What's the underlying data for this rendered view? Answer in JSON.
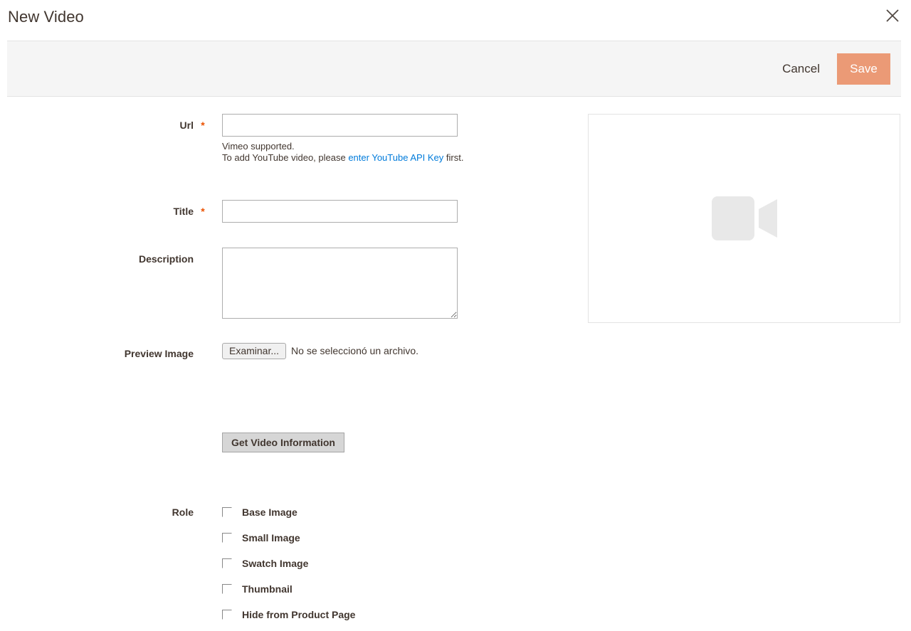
{
  "modal": {
    "title": "New Video",
    "close_icon": "close-icon",
    "toolbar": {
      "cancel_label": "Cancel",
      "save_label": "Save",
      "save_color": "#eb9a76"
    }
  },
  "form": {
    "url": {
      "label": "Url",
      "required_mark": "*",
      "value": "",
      "placeholder": "",
      "note_line1": "Vimeo supported.",
      "note_line2_prefix": "To add YouTube video, please ",
      "note_link": "enter YouTube API Key",
      "note_line2_suffix": " first.",
      "link_color": "#007bdb"
    },
    "title": {
      "label": "Title",
      "required_mark": "*",
      "value": "",
      "placeholder": ""
    },
    "description": {
      "label": "Description",
      "value": "",
      "placeholder": ""
    },
    "preview_image": {
      "label": "Preview Image",
      "browse_label": "Examinar...",
      "chosen_text": "No se seleccionó un archivo."
    },
    "get_info_button": {
      "label": "Get Video Information"
    },
    "role": {
      "label": "Role",
      "options": [
        {
          "label": "Base Image",
          "checked": false
        },
        {
          "label": "Small Image",
          "checked": false
        },
        {
          "label": "Swatch Image",
          "checked": false
        },
        {
          "label": "Thumbnail",
          "checked": false
        },
        {
          "label": "Hide from Product Page",
          "checked": false
        }
      ]
    }
  },
  "preview_panel": {
    "icon": "video-camera-icon",
    "icon_color": "#e8e8e8"
  }
}
